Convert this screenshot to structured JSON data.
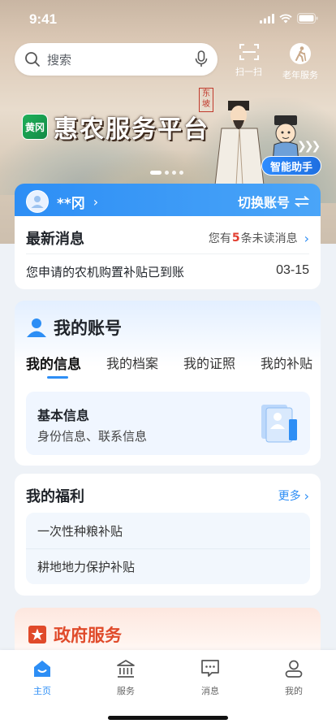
{
  "status_bar": {
    "time": "9:41"
  },
  "search": {
    "placeholder": "搜索",
    "icon": "search-icon",
    "mic_icon": "mic-icon"
  },
  "top_actions": [
    {
      "label": "扫一扫",
      "icon": "scan-icon"
    },
    {
      "label": "老年服务",
      "icon": "elder-service-icon"
    }
  ],
  "banner": {
    "app_badge": "黄冈",
    "title": "惠农服务平台",
    "seal_text": "东坡",
    "assistant_label": "智能助手",
    "slide_count": 4,
    "active_slide": 0
  },
  "account": {
    "name": "**冈",
    "switch_label": "切换账号",
    "switch_icon": "swap-icon"
  },
  "messages": {
    "title": "最新消息",
    "unread_prefix": "您有",
    "unread_count": "5",
    "unread_suffix": "条未读消息",
    "latest_text": "您申请的农机购置补贴已到账",
    "latest_date": "03-15"
  },
  "my_account": {
    "title": "我的账号",
    "icon": "user-icon",
    "tabs": [
      "我的信息",
      "我的档案",
      "我的证照",
      "我的补贴"
    ],
    "active_tab": 0,
    "basic_info": {
      "title": "基本信息",
      "subtitle": "身份信息、联系信息",
      "icon": "id-card-icon"
    }
  },
  "welfare": {
    "title": "我的福利",
    "more_label": "更多",
    "items": [
      "一次性种粮补贴",
      "耕地地力保护补贴"
    ]
  },
  "gov_services": {
    "title": "政府服务",
    "icon": "gov-star-icon"
  },
  "bottom_nav": [
    {
      "label": "主页",
      "icon": "home-icon",
      "active": true
    },
    {
      "label": "服务",
      "icon": "bank-icon",
      "active": false
    },
    {
      "label": "消息",
      "icon": "message-icon",
      "active": false
    },
    {
      "label": "我的",
      "icon": "profile-icon",
      "active": false
    }
  ],
  "colors": {
    "accent": "#2d8ef5",
    "unread_red": "#e23d2f",
    "gov_red": "#e04a2a"
  }
}
